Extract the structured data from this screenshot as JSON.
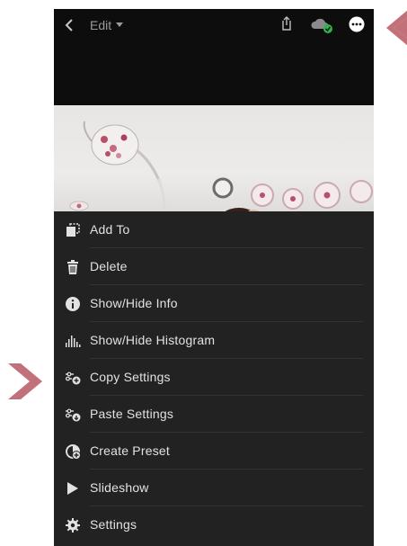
{
  "header": {
    "edit_label": "Edit",
    "icons": [
      "back-icon",
      "share-icon",
      "cloud-sync-icon",
      "more-options-icon"
    ]
  },
  "colors": {
    "menu_bg": "#222222",
    "topbar_bg": "#0d0d0d",
    "cloud_check": "#2fb34f",
    "pointer_arrow": "#c2707a"
  },
  "menu": {
    "items": [
      {
        "label": "Add To",
        "icon": "add-to-icon"
      },
      {
        "label": "Delete",
        "icon": "trash-icon"
      },
      {
        "label": "Show/Hide Info",
        "icon": "info-icon"
      },
      {
        "label": "Show/Hide Histogram",
        "icon": "histogram-icon"
      },
      {
        "label": "Copy Settings",
        "icon": "copy-settings-icon"
      },
      {
        "label": "Paste Settings",
        "icon": "paste-settings-icon"
      },
      {
        "label": "Create Preset",
        "icon": "create-preset-icon"
      },
      {
        "label": "Slideshow",
        "icon": "play-icon"
      },
      {
        "label": "Settings",
        "icon": "gear-icon"
      }
    ]
  }
}
